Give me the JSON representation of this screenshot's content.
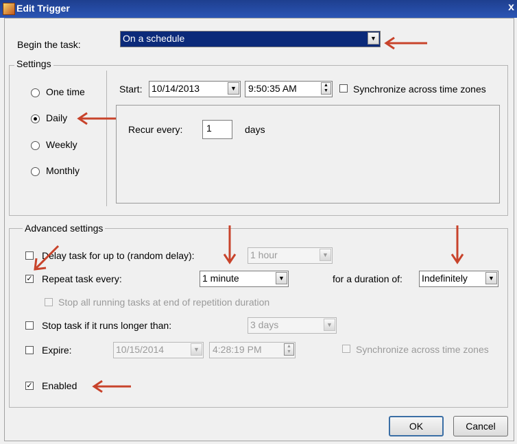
{
  "window": {
    "title": "Edit Trigger",
    "close_glyph": "x"
  },
  "begin_task": {
    "label": "Begin the task:",
    "value": "On a schedule"
  },
  "settings": {
    "group_title": "Settings",
    "options": [
      "One time",
      "Daily",
      "Weekly",
      "Monthly"
    ],
    "selected": "Daily",
    "start_label": "Start:",
    "start_date": "10/14/2013",
    "start_time": "9:50:35 AM",
    "sync_label": "Synchronize across time zones",
    "recur_label": "Recur every:",
    "recur_value": "1",
    "recur_unit": "days"
  },
  "advanced": {
    "group_title": "Advanced settings",
    "delay_label": "Delay task for up to (random delay):",
    "delay_value": "1 hour",
    "repeat_label": "Repeat task every:",
    "repeat_value": "1 minute",
    "duration_label": "for a duration of:",
    "duration_value": "Indefinitely",
    "stop_all_label": "Stop all running tasks at end of repetition duration",
    "stop_long_label": "Stop task if it runs longer than:",
    "stop_long_value": "3 days",
    "expire_label": "Expire:",
    "expire_date": "10/15/2014",
    "expire_time": "4:28:19 PM",
    "expire_sync_label": "Synchronize across time zones",
    "enabled_label": "Enabled",
    "check_glyph": "✓"
  },
  "buttons": {
    "ok": "OK",
    "cancel": "Cancel"
  },
  "combo_glyph": "▼",
  "spin_up_glyph": "▲",
  "spin_down_glyph": "▼",
  "colors": {
    "annotation_arrow": "#c8432b",
    "title_bar": "#1e3f8f",
    "selection": "#0b2a7a"
  }
}
